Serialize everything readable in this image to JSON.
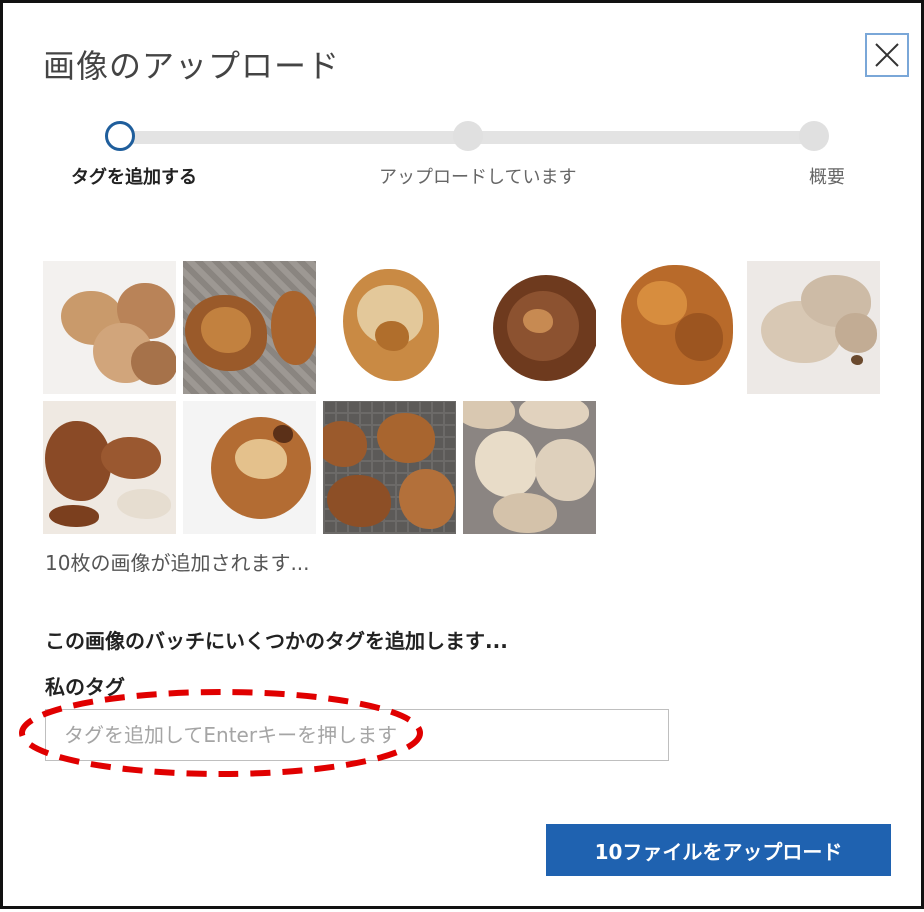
{
  "dialog": {
    "title": "画像のアップロード",
    "close_icon": "close-icon"
  },
  "stepper": {
    "current_step": 1,
    "steps": [
      {
        "label": "タグを追加する",
        "state": "current"
      },
      {
        "label": "アップロードしています",
        "state": "pending"
      },
      {
        "label": "概要",
        "state": "pending"
      }
    ]
  },
  "gallery": {
    "image_count": 10,
    "count_text": "10枚の画像が追加されます..."
  },
  "tags": {
    "section_title": "この画像のバッチにいくつかのタグを追加します...",
    "label": "私のタグ",
    "placeholder": "タグを追加してEnterキーを押します",
    "value": ""
  },
  "actions": {
    "upload_label": "10ファイルをアップロード"
  },
  "colors": {
    "accent": "#1f62b0",
    "step_current": "#1f5e9c",
    "annotation": "#e00000"
  }
}
